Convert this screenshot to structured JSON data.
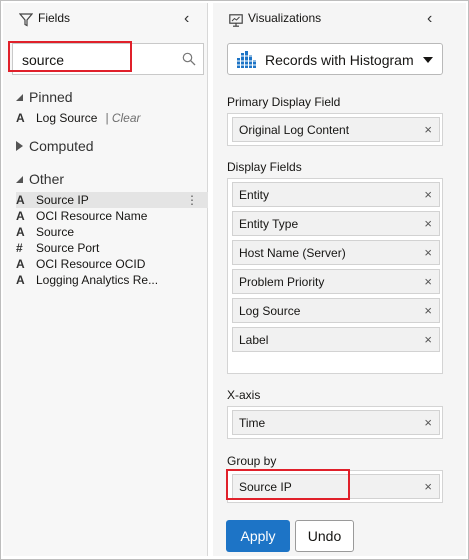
{
  "fields_panel": {
    "title": "Fields",
    "search": {
      "value": "source"
    },
    "sections": {
      "pinned": {
        "label": "Pinned",
        "items": [
          {
            "type": "A",
            "name": "Log Source",
            "clear": "| Clear"
          }
        ]
      },
      "computed": {
        "label": "Computed"
      },
      "other": {
        "label": "Other",
        "items": [
          {
            "type": "A",
            "name": "Source IP"
          },
          {
            "type": "A",
            "name": "OCI Resource Name"
          },
          {
            "type": "A",
            "name": "Source"
          },
          {
            "type": "#",
            "name": "Source Port"
          },
          {
            "type": "A",
            "name": "OCI Resource OCID"
          },
          {
            "type": "A",
            "name": "Logging Analytics Re..."
          }
        ]
      }
    }
  },
  "viz_panel": {
    "title": "Visualizations",
    "selected_viz": "Records with Histogram",
    "primary_display_field": {
      "label": "Primary Display Field",
      "value": "Original Log Content"
    },
    "display_fields": {
      "label": "Display Fields",
      "items": [
        "Entity",
        "Entity Type",
        "Host Name (Server)",
        "Problem Priority",
        "Log Source",
        "Label"
      ]
    },
    "x_axis": {
      "label": "X-axis",
      "value": "Time"
    },
    "group_by": {
      "label": "Group by",
      "value": "Source IP"
    },
    "buttons": {
      "apply": "Apply",
      "undo": "Undo"
    },
    "remove_glyph": "×"
  },
  "colors": {
    "accent": "#1d74c6",
    "highlight": "#e0202a"
  }
}
